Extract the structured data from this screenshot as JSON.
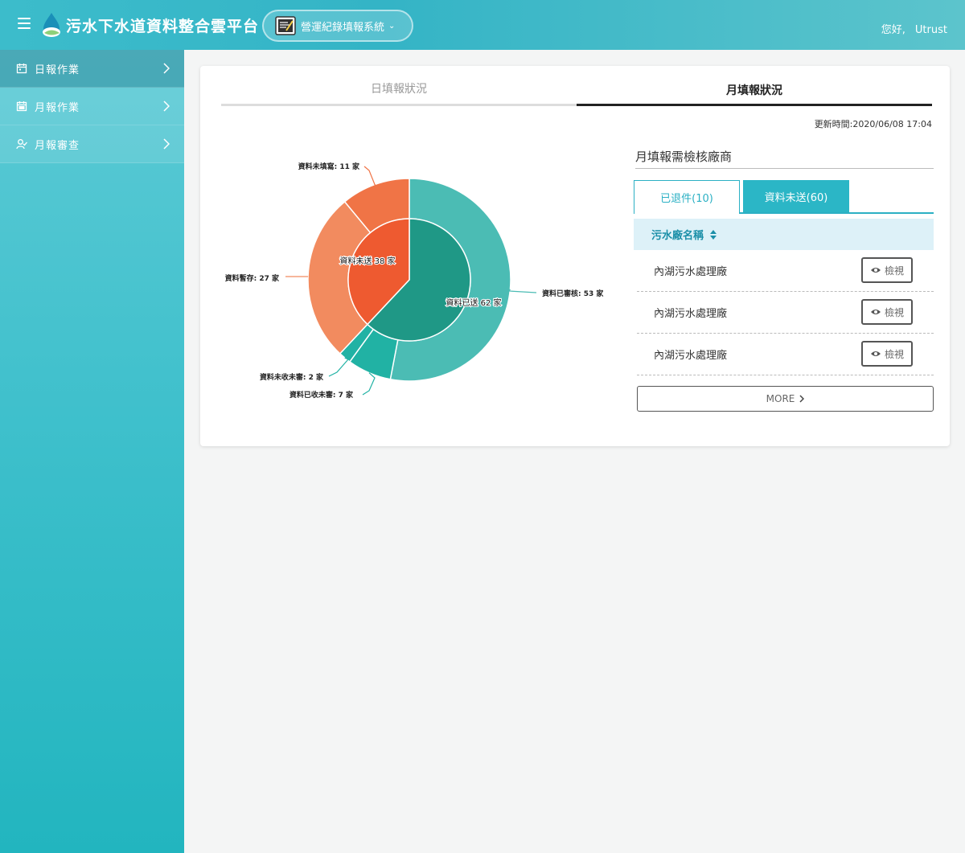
{
  "header": {
    "title": "污水下水道資料整合雲平台",
    "system_selector": "營運紀錄填報系統",
    "greeting": "您好,",
    "username": "Utrust"
  },
  "sidebar": {
    "items": [
      {
        "label": "日報作業",
        "icon": "calendar-icon"
      },
      {
        "label": "月報作業",
        "icon": "calendar-grid-icon"
      },
      {
        "label": "月報審查",
        "icon": "user-check-icon"
      }
    ]
  },
  "tabs": {
    "daily": "日填報狀況",
    "monthly": "月填報狀況"
  },
  "updated": "更新時間:2020/06/08 17:04",
  "right_panel": {
    "title": "月填報需檢核廠商",
    "subtab_returned": "已退件(10)",
    "subtab_not_sent": "資料未送(60)",
    "column_header": "污水廠名稱",
    "rows": [
      {
        "name": "內湖污水處理廠",
        "action": "檢視"
      },
      {
        "name": "內湖污水處理廠",
        "action": "檢視"
      },
      {
        "name": "內湖污水處理廠",
        "action": "檢視"
      }
    ],
    "more_label": "MORE"
  },
  "colors": {
    "brand": "#3cbccb",
    "teal_outer": "#4bbcb4",
    "teal_inner": "#1f9886",
    "teal_small": "#21b2a4",
    "orange_outer": "#f28b5f",
    "orange_inner": "#ee5a30",
    "orange_top": "#f07446"
  },
  "chart_data": {
    "type": "pie",
    "inner": [
      {
        "label": "資料已送",
        "value": 62,
        "unit": "家",
        "color": "#1f9886"
      },
      {
        "label": "資料未送",
        "value": 38,
        "unit": "家",
        "color": "#ee5a30"
      }
    ],
    "outer": [
      {
        "label": "資料已審核",
        "value": 53,
        "unit": "家",
        "color": "#4bbcb4"
      },
      {
        "label": "資料已收未審",
        "value": 7,
        "unit": "家",
        "color": "#21b2a4"
      },
      {
        "label": "資料未收未審",
        "value": 2,
        "unit": "家",
        "color": "#21b2a4"
      },
      {
        "label": "資料暫存",
        "value": 27,
        "unit": "家",
        "color": "#f28b5f"
      },
      {
        "label": "資料未填寫",
        "value": 11,
        "unit": "家",
        "color": "#f07446"
      }
    ],
    "inner_labels": [
      "資料已送 62 家",
      "資料未送 38 家"
    ],
    "outer_labels": [
      "資料已審核: 53 家",
      "資料已收未審: 7 家",
      "資料未收未審: 2 家",
      "資料暫存: 27 家",
      "資料未填寫: 11 家"
    ]
  }
}
